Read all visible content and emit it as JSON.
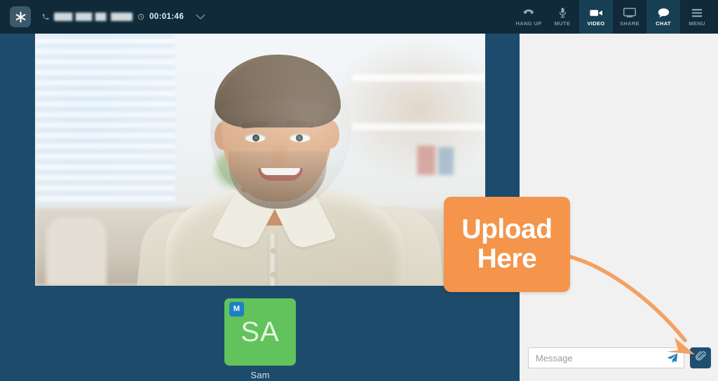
{
  "app": {
    "brand_icon": "asterisk-logo-icon",
    "background_color": "#1d4b6b",
    "topbar_color": "#102a39",
    "accent_color": "#f4954b",
    "chat_panel_color": "#f1f1f1"
  },
  "topbar": {
    "call": {
      "phone_icon": "phone-icon",
      "number_masked": "",
      "clock_icon": "clock-icon",
      "timer": "00:01:46",
      "caret_icon": "chevron-down-icon"
    },
    "tools": [
      {
        "id": "hang-up",
        "label": "HANG UP",
        "icon": "hangup-icon",
        "active": false
      },
      {
        "id": "mute",
        "label": "MUTE",
        "icon": "microphone-icon",
        "active": false
      },
      {
        "id": "video",
        "label": "VIDEO",
        "icon": "video-camera-icon",
        "active": true
      },
      {
        "id": "share",
        "label": "SHARE",
        "icon": "monitor-share-icon",
        "active": false
      },
      {
        "id": "chat",
        "label": "CHAT",
        "icon": "chat-bubble-icon",
        "active": true
      },
      {
        "id": "menu",
        "label": "MENU",
        "icon": "hamburger-menu-icon",
        "active": false
      }
    ]
  },
  "stage": {
    "video_alt": "remote participant video feed",
    "participant": {
      "initials": "SA",
      "name": "Sam",
      "badge": "M",
      "avatar_color": "#62c25b",
      "badge_color": "#1f7fc4"
    }
  },
  "chat": {
    "input_value": "",
    "input_placeholder": "Message",
    "send_icon": "send-paper-plane-icon",
    "attach_icon": "paperclip-icon",
    "attach_button_color": "#1f4f6e"
  },
  "annotation": {
    "line1": "Upload",
    "line2": "Here",
    "arrow_icon": "curved-arrow-icon",
    "color": "#f4954b"
  }
}
